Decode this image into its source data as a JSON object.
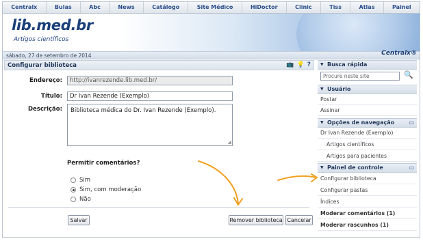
{
  "topnav": [
    "Centralx",
    "Bulas",
    "Abc",
    "News",
    "Catálogo",
    "Site Médico",
    "HiDoctor",
    "Clinic",
    "Tiss",
    "Atlas",
    "Painel"
  ],
  "banner": {
    "logo": "lib.med.br",
    "subtitle": "Artigos científicos"
  },
  "datebar": {
    "date": "sábado, 27 de setembro de 2014",
    "brand": "Centralx®"
  },
  "main": {
    "title": "Configurar biblioteca",
    "tools": [
      "tv-icon",
      "lightbulb-icon",
      "help-icon"
    ],
    "tool_glyphs": [
      "📺",
      "💡",
      "?"
    ],
    "endereco_label": "Endereço:",
    "endereco_value": "http://ivanrezende.lib.med.br/",
    "titulo_label": "Título:",
    "titulo_value": "Dr Ivan Rezende (Exemplo)",
    "descricao_label": "Descrição:",
    "descricao_value": "Biblioteca médica do Dr. Ivan Rezende (Exemplo).",
    "permitir_label": "Permitir comentários?",
    "radio_options": [
      "Sim",
      "Sim, com moderação",
      "Não"
    ],
    "radio_selected": 1,
    "save_label": "Salvar",
    "remove_label": "Remover biblioteca",
    "cancel_label": "Cancelar"
  },
  "sidebar": {
    "busca_title": "Busca rápida",
    "search_placeholder": "Procure neste site",
    "usuario_title": "Usuário",
    "usuario_items": [
      "Postar",
      "Assinar"
    ],
    "nav_title": "Opções de navegação",
    "nav_items": [
      "Dr Ivan Rezende (Exemplo)",
      "Artigos científicos",
      "Artigos para pacientes"
    ],
    "painel_title": "Painel de controle",
    "painel_items": [
      "Configurar biblioteca",
      "Configurar pastas",
      "Índices",
      "Moderar comentários (1)",
      "Moderar rascunhos (1)"
    ]
  },
  "colors": {
    "accent": "#2a4e8a",
    "arrow": "#f0a020"
  }
}
